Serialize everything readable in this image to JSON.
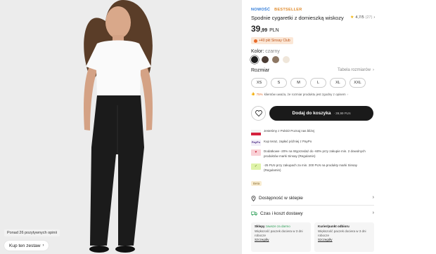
{
  "photo": {
    "reviews_badge": "Ponad 26 pozytywnych opinii",
    "set_button_label": "Kup ten zestaw",
    "set_button_arrow": "›"
  },
  "product": {
    "badge_new": "NOWOŚĆ",
    "badge_bestseller": "BESTSELLER",
    "title": "Spodnie cygaretki z domieszką wiskozy",
    "rating_value": "4,7/5",
    "rating_count": "(27)",
    "price_main": "39",
    "price_cents": ",99",
    "price_currency": "PLN",
    "club_text": "+40 pkt Sinsay Club",
    "color_label": "Kolor:",
    "color_value": "czarny",
    "swatches": [
      "#1c1c1c",
      "#4a3b32",
      "#8d7763",
      "#efe6da"
    ],
    "size_label": "Rozmiar",
    "size_table_link": "Tabela rozmiarów",
    "sizes": [
      "XS",
      "S",
      "M",
      "L",
      "XL",
      "XXL"
    ],
    "fit_pct": "75%",
    "fit_text": "klientów uważa, że rozmiar produktu jest zgodny z opisem",
    "fit_link": "rozmiarem"
  },
  "actions": {
    "add_to_cart_label": "Dodaj do koszyka",
    "add_to_cart_price": "· 39,99 PLN"
  },
  "info": {
    "made_in_poland": "Jesteśmy z Polski! Poznaj nas bliżej",
    "paypo_label": "PayPo",
    "paypo_text": "Kup teraz, zapłać później z PayPo",
    "discount_text": "Dodatkowe -20% na Wyprzedaż do -60% przy zakupie min. 2 dowolnych produktów marki Sinsay (Regulamin)",
    "coupon_text": "-25 PLN przy zakupach za min. 200 PLN na produkty marki Sinsay (Regulamin)",
    "beta_label": "Beta"
  },
  "sections": {
    "availability": "Dostępność w sklepie",
    "delivery": "Czas i koszt dostawy"
  },
  "delivery_cards": [
    {
      "title": "Sklepy",
      "free": "zawsze za darmo",
      "text": "Większość paczek dociera w 3 dni robocze",
      "more": "Szczegóły"
    },
    {
      "title": "Kurier/punkt odbioru",
      "free": "",
      "text": "Większość paczek dociera w 3 dni robocze",
      "more": "Szczegóły"
    }
  ],
  "icons": {
    "rating": "star-icon",
    "favorite": "heart-outline-icon",
    "availability": "location-pin-icon",
    "delivery": "truck-icon",
    "chevron": "chevron-right-icon"
  },
  "colors": {
    "accent_blue": "#2e7ad8",
    "accent_orange": "#e08b2d",
    "cart_button": "#1a1a1a",
    "free_green": "#2a9d54"
  }
}
